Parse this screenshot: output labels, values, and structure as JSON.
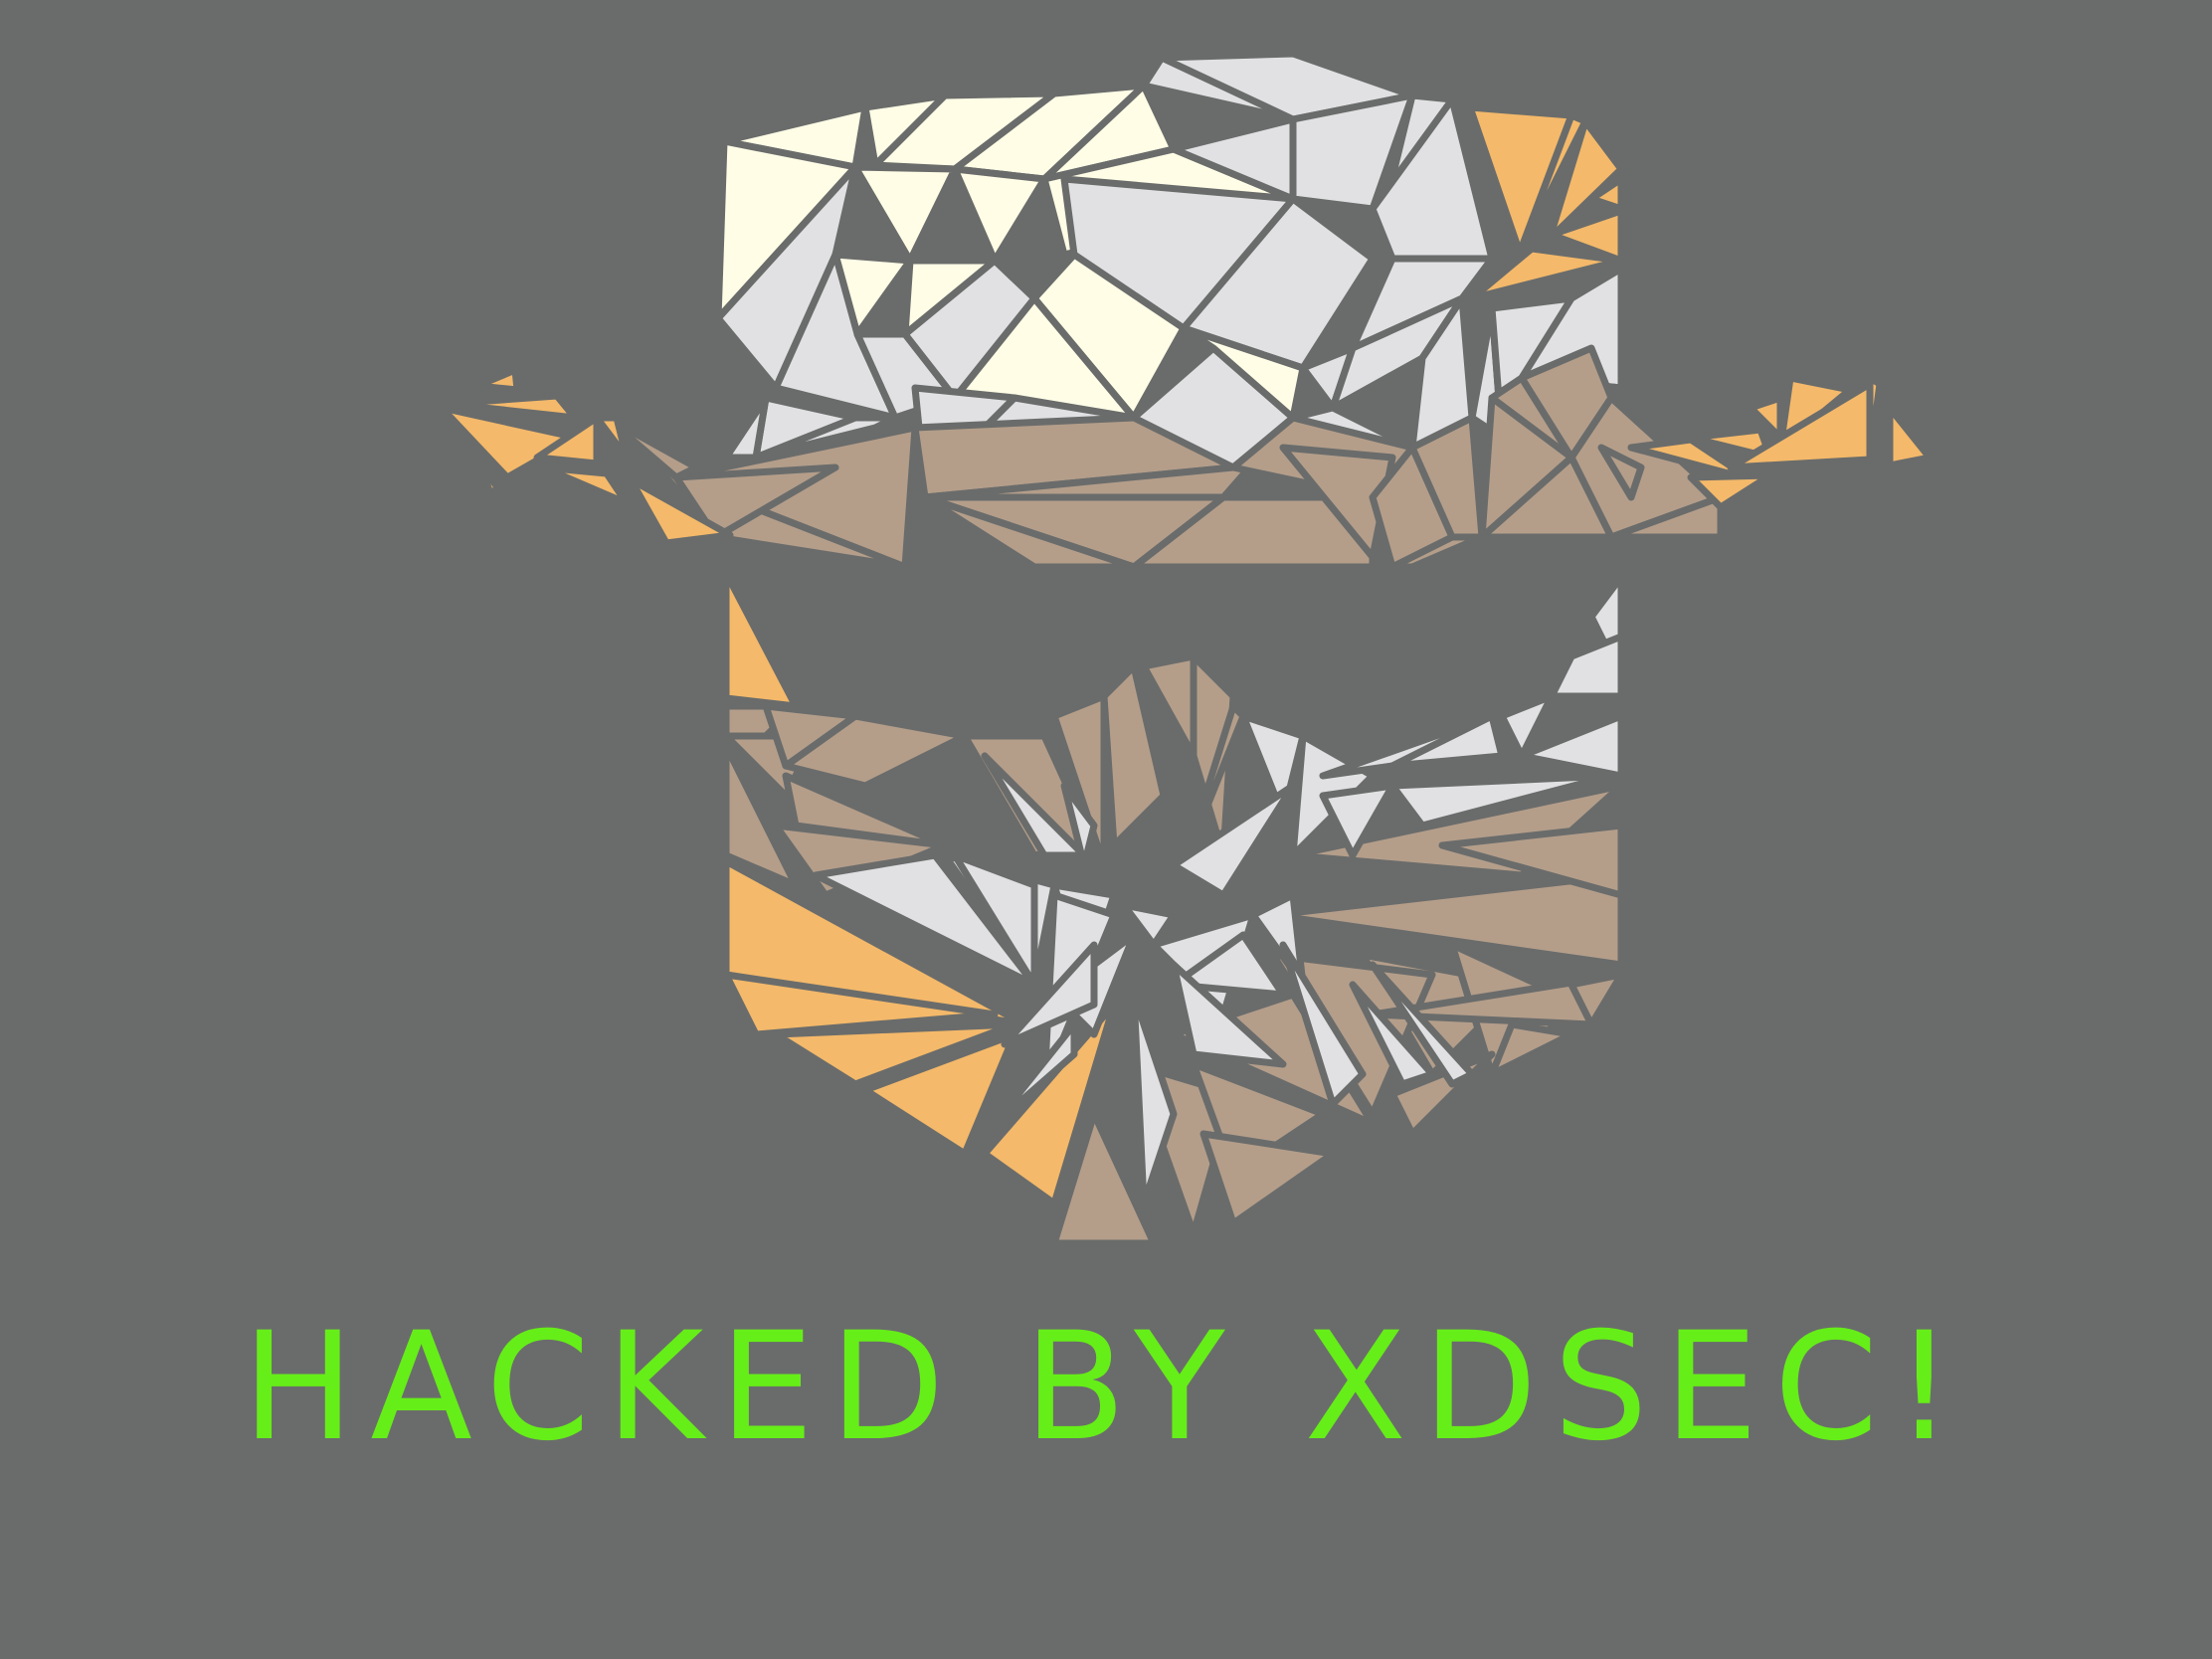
{
  "banner": {
    "text": "HACKED BY XDSEC!"
  },
  "colors": {
    "background": "#6a6c6b",
    "banner_text": "#66ee18",
    "cream": "#fffde6",
    "light_gray": "#e1e1e3",
    "tan": "#b49e8a",
    "orange": "#f4b96a"
  },
  "icon": "fedora-hat-masked-man-icon"
}
